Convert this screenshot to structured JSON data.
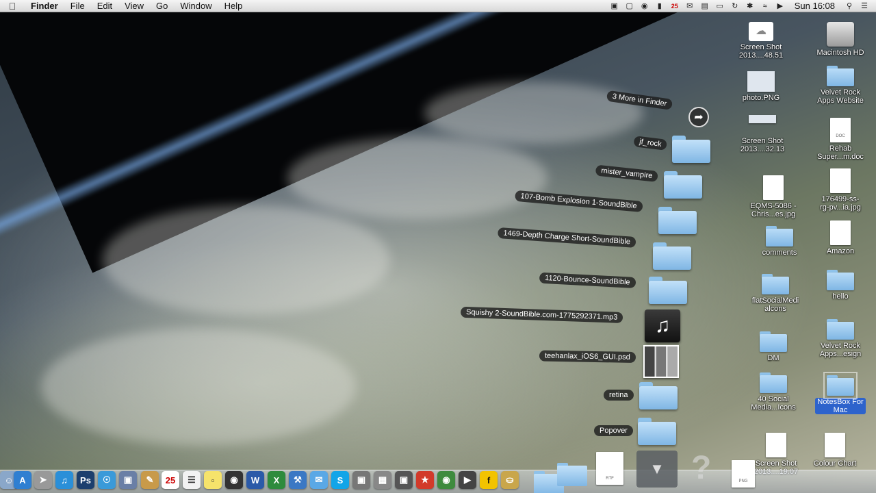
{
  "menubar": {
    "app_name": "Finder",
    "menus": [
      "File",
      "Edit",
      "View",
      "Go",
      "Window",
      "Help"
    ],
    "status_icons": [
      "hdd-icon",
      "screen-icon",
      "globe-icon",
      "bookmark-icon",
      "calendar-icon",
      "chat-icon",
      "folder-icon",
      "display-icon",
      "time-machine-icon",
      "bluetooth-icon",
      "wifi-icon",
      "volume-icon"
    ],
    "calendar_badge": "25",
    "clock": "Sun 16:08"
  },
  "desktop_icons": {
    "screen_shot_1": "Screen Shot\n2013....48.51",
    "macintosh_hd": "Macintosh HD",
    "photo_png": "photo.PNG",
    "velvet_rock_web": "Velvet Rock\nApps Website",
    "screen_shot_2": "Screen Shot\n2013....32.13",
    "rehab_doc": "Rehab\nSuper...m.doc",
    "eqms": "EQMS-5086 -\nChris...es.jpg",
    "jpg_176499": "176499-ss-\nrg-pv...ia.jpg",
    "comments": "comments",
    "amazon": "Amazon",
    "flat_social": "flatSocialMedi\nalcons",
    "hello": "hello",
    "dm": "DM",
    "velvet_rock_design": "Velvet Rock\nApps...esign",
    "social_40": "40 Social\nMedia...Icons",
    "notesbox": "NotesBox For\nMac",
    "screen_shot_3": "Screen Shot\n2013....19.07",
    "colour_chart": "Colour Chart",
    "doc_badge": "DOC"
  },
  "fan_stack": {
    "more": "3 More in Finder",
    "items": [
      "jf_rock",
      "mister_vampire",
      "107-Bomb Explosion 1-SoundBible",
      "1469-Depth Charge Short-SoundBible",
      "1120-Bounce-SoundBible",
      "Squishy 2-SoundBible.com-1775292371.mp3",
      "teehanlax_iOS6_GUI.psd",
      "retina",
      "Popover"
    ]
  },
  "dock": {
    "icons": [
      "finder",
      "app-store",
      "launchpad",
      "itunes",
      "photoshop",
      "safari",
      "preview",
      "notes",
      "calendar",
      "reminders",
      "stickies",
      "disk",
      "word",
      "excel",
      "xcode",
      "messages",
      "skype",
      "image-capture",
      "calculator",
      "photo-booth",
      "wunderlist",
      "evernote",
      "clapper",
      "facebook",
      "truck"
    ],
    "rtf_label": "RTF",
    "png_label": "PNG"
  }
}
